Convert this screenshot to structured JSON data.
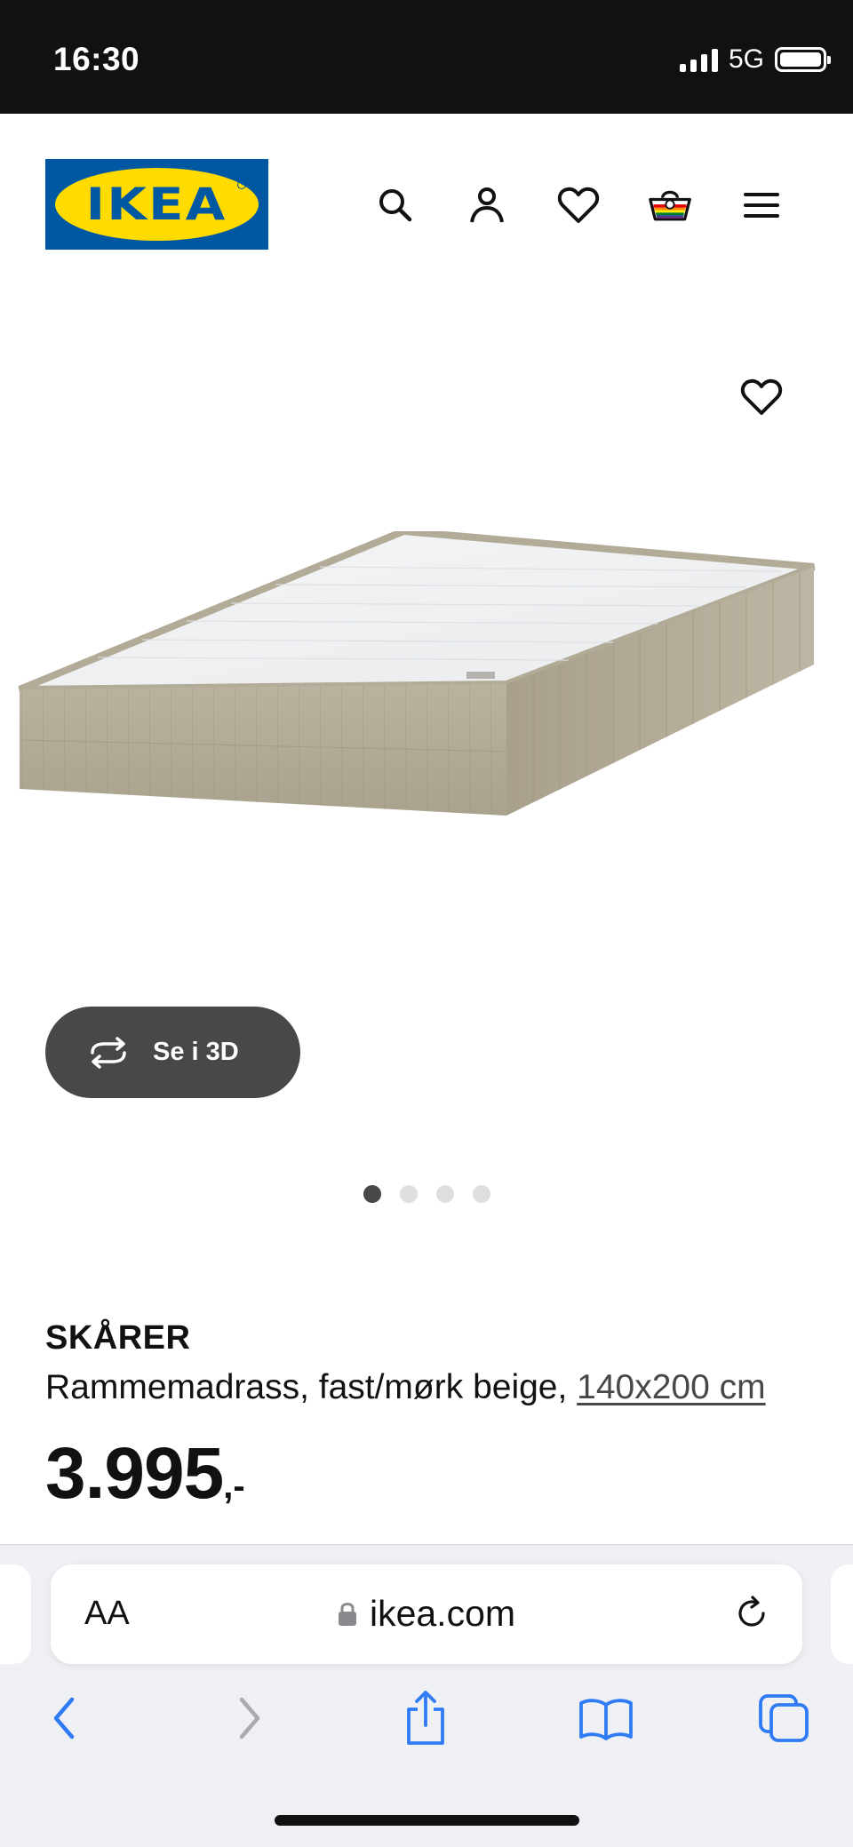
{
  "status_bar": {
    "time": "16:30",
    "network": "5G"
  },
  "header": {
    "logo_text": "IKEA"
  },
  "gallery": {
    "view_3d_label": "Se i 3D",
    "dot_count": 4,
    "active_dot": 0
  },
  "product": {
    "name": "SKÅRER",
    "description": "Rammemadrass, fast/mørk beige,",
    "size": "140x200 cm",
    "price": "3.995",
    "price_suffix": ",-"
  },
  "browser": {
    "text_size_label": "AA",
    "url": "ikea.com"
  },
  "colors": {
    "ikea_blue": "#0058a3",
    "ikea_yellow": "#ffdb00",
    "button_dark": "#484848",
    "fabric_beige": "#b2ab97"
  }
}
